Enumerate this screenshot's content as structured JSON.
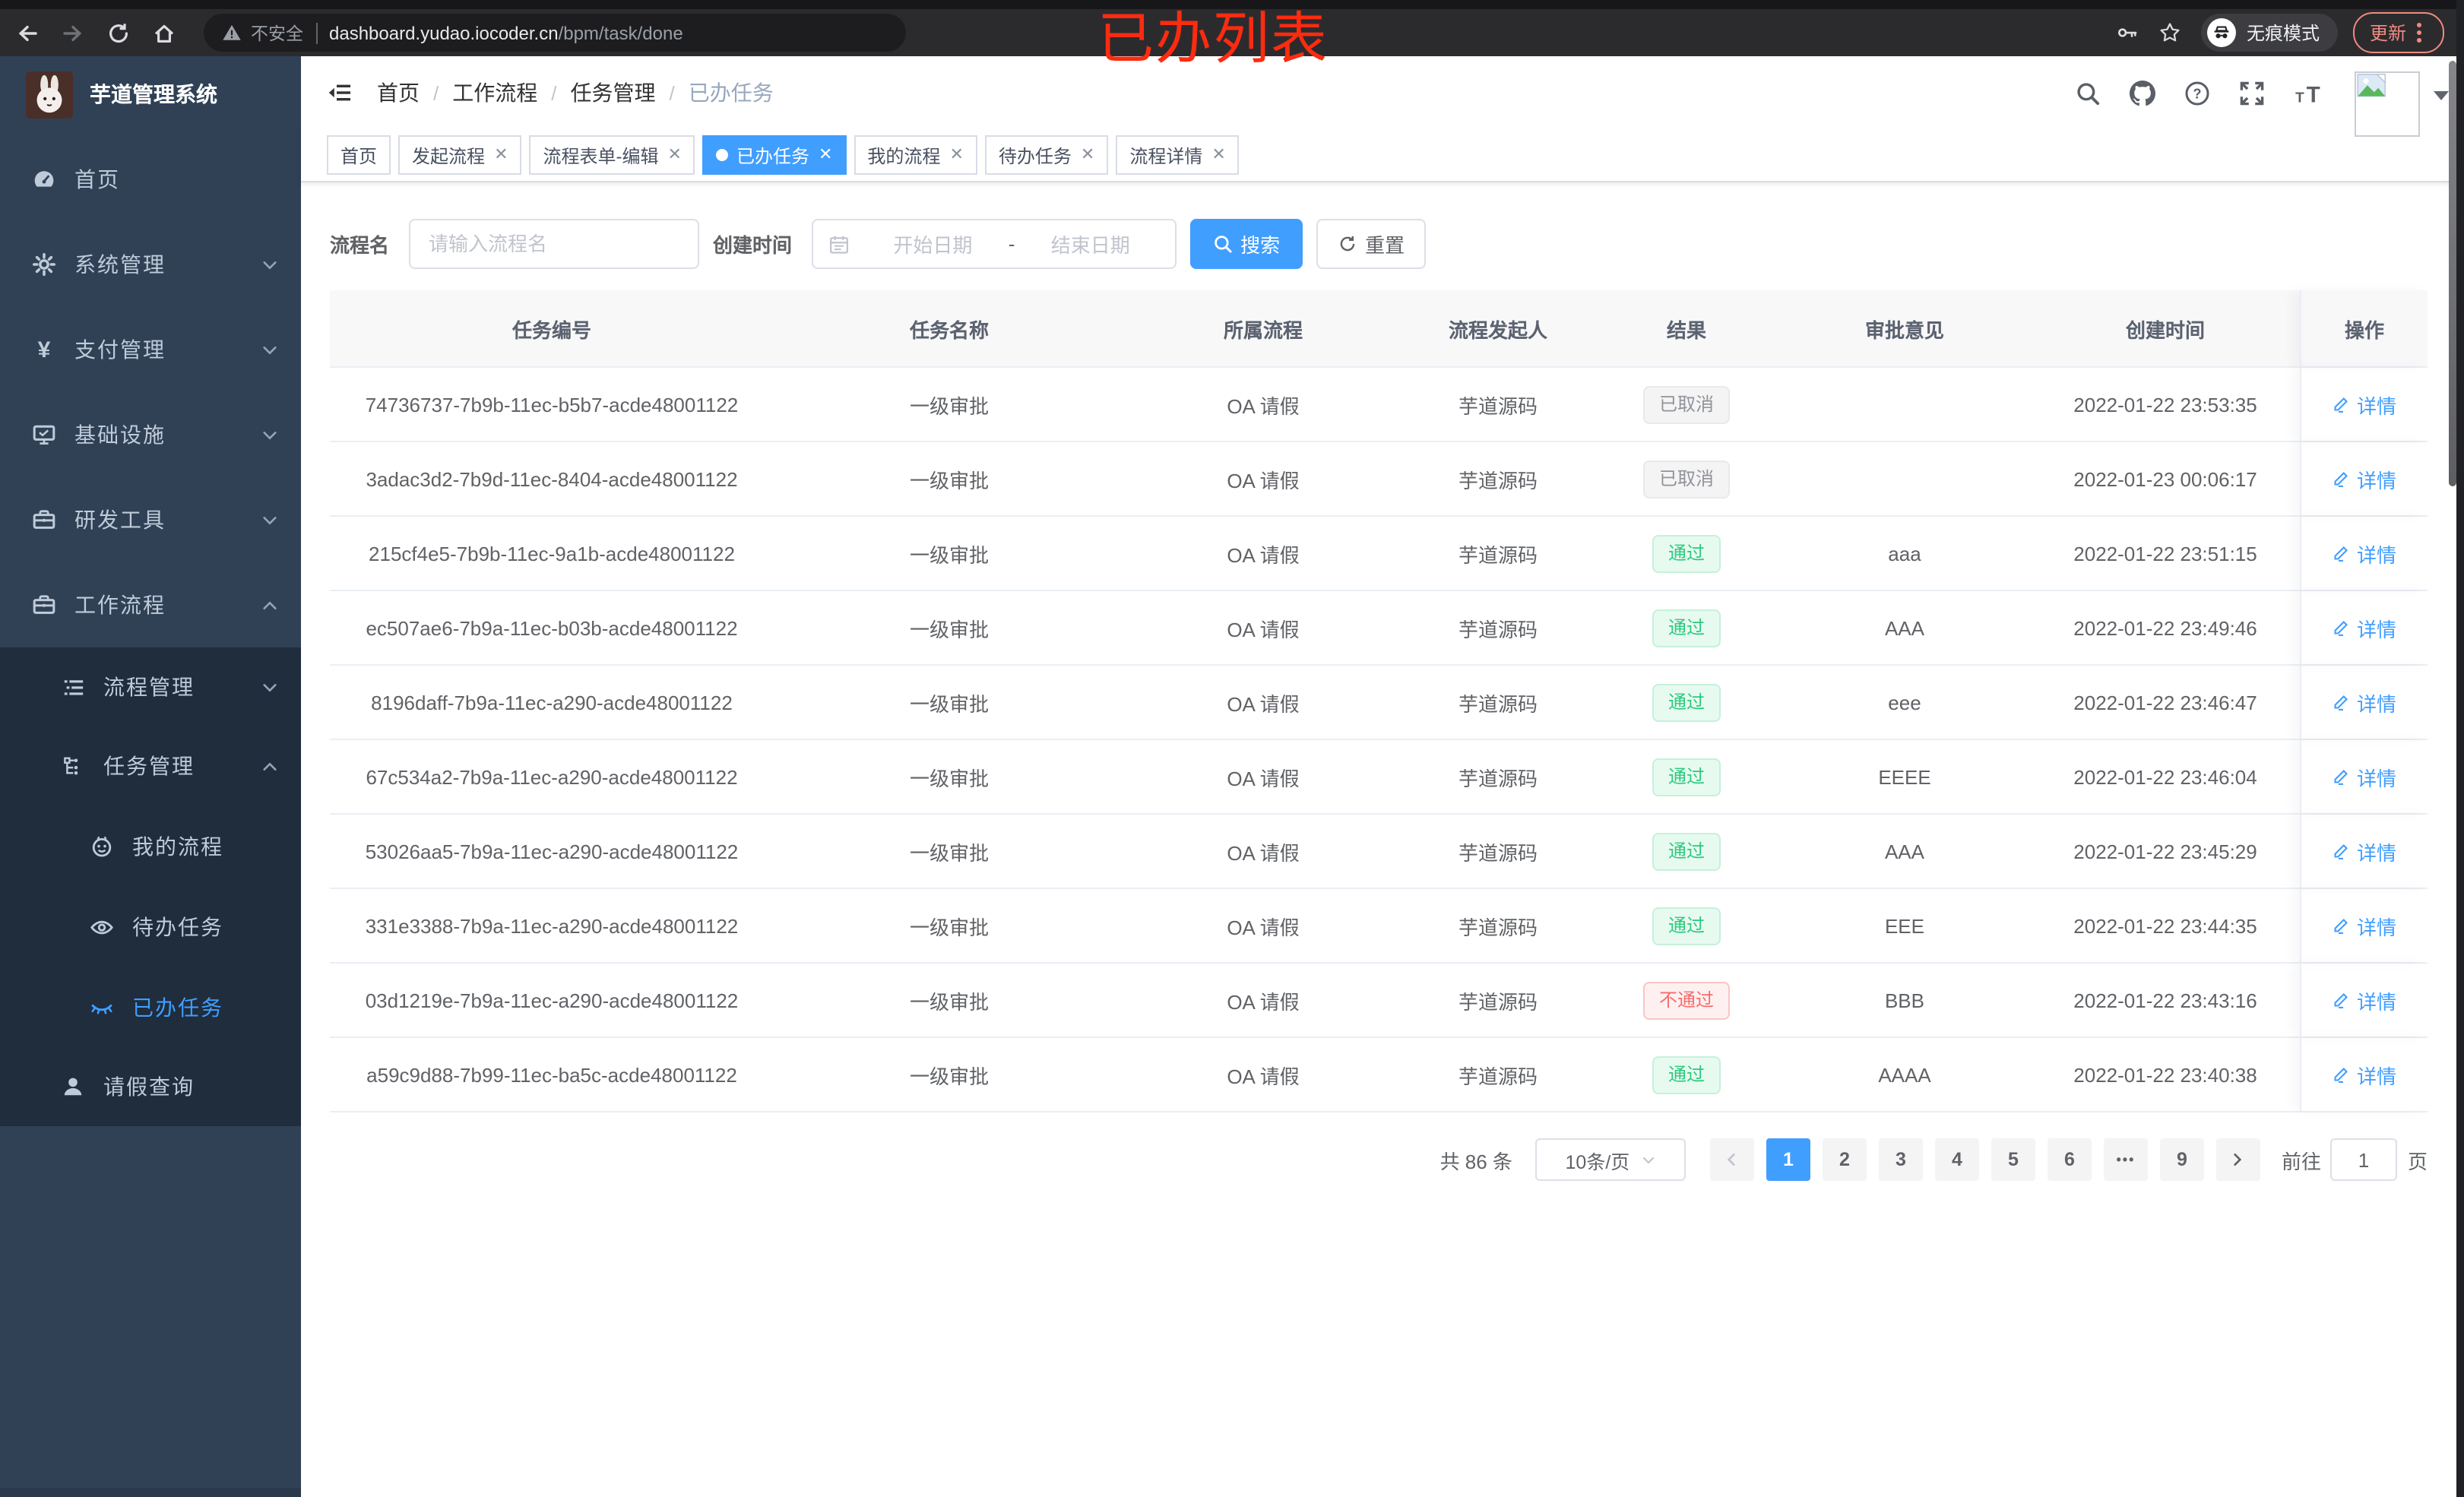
{
  "browser": {
    "security_label": "不安全",
    "url_host": "dashboard.yudao.iocoder.cn",
    "url_path": "/bpm/task/done",
    "incognito_label": "无痕模式",
    "update_label": "更新",
    "annotation": "已办列表"
  },
  "sidebar": {
    "title": "芋道管理系统",
    "items": [
      {
        "label": "首页",
        "icon": "dashboard-icon"
      },
      {
        "label": "系统管理",
        "icon": "gear-icon"
      },
      {
        "label": "支付管理",
        "icon": "yen-icon"
      },
      {
        "label": "基础设施",
        "icon": "monitor-icon"
      },
      {
        "label": "研发工具",
        "icon": "toolbox-icon"
      },
      {
        "label": "工作流程",
        "icon": "toolbox-icon"
      },
      {
        "label": "流程管理",
        "icon": "list-icon"
      },
      {
        "label": "任务管理",
        "icon": "tree-icon"
      },
      {
        "label": "我的流程",
        "icon": "face-icon"
      },
      {
        "label": "待办任务",
        "icon": "eye-icon"
      },
      {
        "label": "已办任务",
        "icon": "eye-closed-icon"
      },
      {
        "label": "请假查询",
        "icon": "user-icon"
      }
    ]
  },
  "navbar": {
    "breadcrumbs": [
      "首页",
      "工作流程",
      "任务管理",
      "已办任务"
    ]
  },
  "tabs": [
    {
      "label": "首页",
      "closable": false,
      "active": false
    },
    {
      "label": "发起流程",
      "closable": true,
      "active": false
    },
    {
      "label": "流程表单-编辑",
      "closable": true,
      "active": false
    },
    {
      "label": "已办任务",
      "closable": true,
      "active": true
    },
    {
      "label": "我的流程",
      "closable": true,
      "active": false
    },
    {
      "label": "待办任务",
      "closable": true,
      "active": false
    },
    {
      "label": "流程详情",
      "closable": true,
      "active": false
    }
  ],
  "filters": {
    "name_label": "流程名",
    "name_placeholder": "请输入流程名",
    "time_label": "创建时间",
    "start_placeholder": "开始日期",
    "range_separator": "-",
    "end_placeholder": "结束日期",
    "search_label": "搜索",
    "reset_label": "重置"
  },
  "table": {
    "columns": [
      "任务编号",
      "任务名称",
      "所属流程",
      "流程发起人",
      "结果",
      "审批意见",
      "创建时间",
      "操作"
    ],
    "action_label": "详情",
    "rows": [
      {
        "id": "74736737-7b9b-11ec-b5b7-acde48001122",
        "name": "一级审批",
        "process": "OA 请假",
        "starter": "芋道源码",
        "result": "已取消",
        "result_type": "info",
        "comment": "",
        "created": "2022-01-22 23:53:35"
      },
      {
        "id": "3adac3d2-7b9d-11ec-8404-acde48001122",
        "name": "一级审批",
        "process": "OA 请假",
        "starter": "芋道源码",
        "result": "已取消",
        "result_type": "info",
        "comment": "",
        "created": "2022-01-23 00:06:17"
      },
      {
        "id": "215cf4e5-7b9b-11ec-9a1b-acde48001122",
        "name": "一级审批",
        "process": "OA 请假",
        "starter": "芋道源码",
        "result": "通过",
        "result_type": "success",
        "comment": "aaa",
        "created": "2022-01-22 23:51:15"
      },
      {
        "id": "ec507ae6-7b9a-11ec-b03b-acde48001122",
        "name": "一级审批",
        "process": "OA 请假",
        "starter": "芋道源码",
        "result": "通过",
        "result_type": "success",
        "comment": "AAA",
        "created": "2022-01-22 23:49:46"
      },
      {
        "id": "8196daff-7b9a-11ec-a290-acde48001122",
        "name": "一级审批",
        "process": "OA 请假",
        "starter": "芋道源码",
        "result": "通过",
        "result_type": "success",
        "comment": "eee",
        "created": "2022-01-22 23:46:47"
      },
      {
        "id": "67c534a2-7b9a-11ec-a290-acde48001122",
        "name": "一级审批",
        "process": "OA 请假",
        "starter": "芋道源码",
        "result": "通过",
        "result_type": "success",
        "comment": "EEEE",
        "created": "2022-01-22 23:46:04"
      },
      {
        "id": "53026aa5-7b9a-11ec-a290-acde48001122",
        "name": "一级审批",
        "process": "OA 请假",
        "starter": "芋道源码",
        "result": "通过",
        "result_type": "success",
        "comment": "AAA",
        "created": "2022-01-22 23:45:29"
      },
      {
        "id": "331e3388-7b9a-11ec-a290-acde48001122",
        "name": "一级审批",
        "process": "OA 请假",
        "starter": "芋道源码",
        "result": "通过",
        "result_type": "success",
        "comment": "EEE",
        "created": "2022-01-22 23:44:35"
      },
      {
        "id": "03d1219e-7b9a-11ec-a290-acde48001122",
        "name": "一级审批",
        "process": "OA 请假",
        "starter": "芋道源码",
        "result": "不通过",
        "result_type": "danger",
        "comment": "BBB",
        "created": "2022-01-22 23:43:16"
      },
      {
        "id": "a59c9d88-7b99-11ec-ba5c-acde48001122",
        "name": "一级审批",
        "process": "OA 请假",
        "starter": "芋道源码",
        "result": "通过",
        "result_type": "success",
        "comment": "AAAA",
        "created": "2022-01-22 23:40:38"
      }
    ]
  },
  "pagination": {
    "total_label": "共 86 条",
    "page_size_label": "10条/页",
    "pages": [
      "1",
      "2",
      "3",
      "4",
      "5",
      "6",
      "•••",
      "9"
    ],
    "active_page": "1",
    "goto_label": "前往",
    "goto_value": "1",
    "unit_label": "页"
  },
  "colors": {
    "primary": "#409eff",
    "success_text": "#2dc97e",
    "danger_text": "#f56c6c",
    "info_text": "#909399",
    "sidebar_bg": "#304156",
    "submenu_bg": "#1f2d3d",
    "annotation_red": "#fd2b10"
  }
}
